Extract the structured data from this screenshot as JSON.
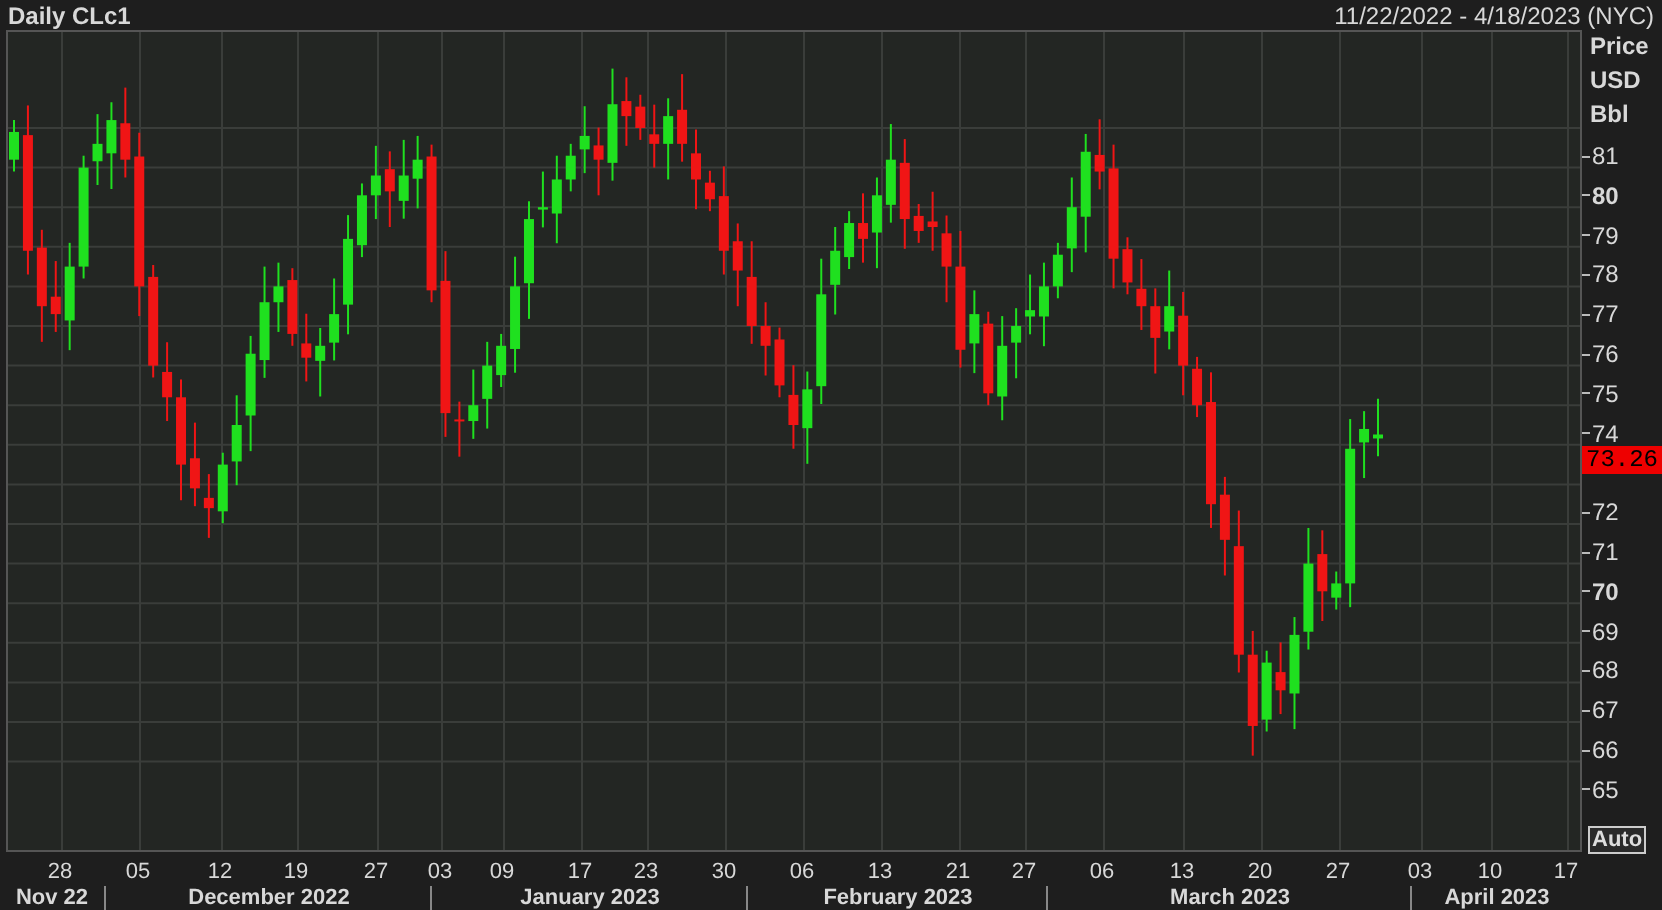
{
  "header": {
    "title": "Daily CLc1",
    "date_range": "11/22/2022 - 4/18/2023 (NYC)"
  },
  "price_axis": {
    "units": [
      "Price",
      "USD",
      "Bbl"
    ],
    "ticks": [
      {
        "label": "81",
        "major": false
      },
      {
        "label": "80",
        "major": true
      },
      {
        "label": "79",
        "major": false
      },
      {
        "label": "78",
        "major": false
      },
      {
        "label": "77",
        "major": false
      },
      {
        "label": "76",
        "major": false
      },
      {
        "label": "75",
        "major": false
      },
      {
        "label": "74",
        "major": false
      },
      {
        "major": false
      },
      {
        "label": "72",
        "major": false
      },
      {
        "label": "71",
        "major": false
      },
      {
        "label": "70",
        "major": true
      },
      {
        "label": "69",
        "major": false
      },
      {
        "label": "68",
        "major": false
      },
      {
        "label": "67",
        "major": false
      },
      {
        "label": "66",
        "major": false
      },
      {
        "label": "65",
        "major": false
      }
    ],
    "last_price": "73.26"
  },
  "date_axis": {
    "days": [
      "28",
      "05",
      "12",
      "19",
      "27",
      "03",
      "09",
      "17",
      "23",
      "30",
      "06",
      "13",
      "21",
      "27",
      "06",
      "13",
      "20",
      "27",
      "03",
      "10",
      "17"
    ],
    "months": [
      "Nov 22",
      "December 2022",
      "January 2023",
      "February 2023",
      "March 2023",
      "April 2023"
    ]
  },
  "auto_button": "Auto"
}
